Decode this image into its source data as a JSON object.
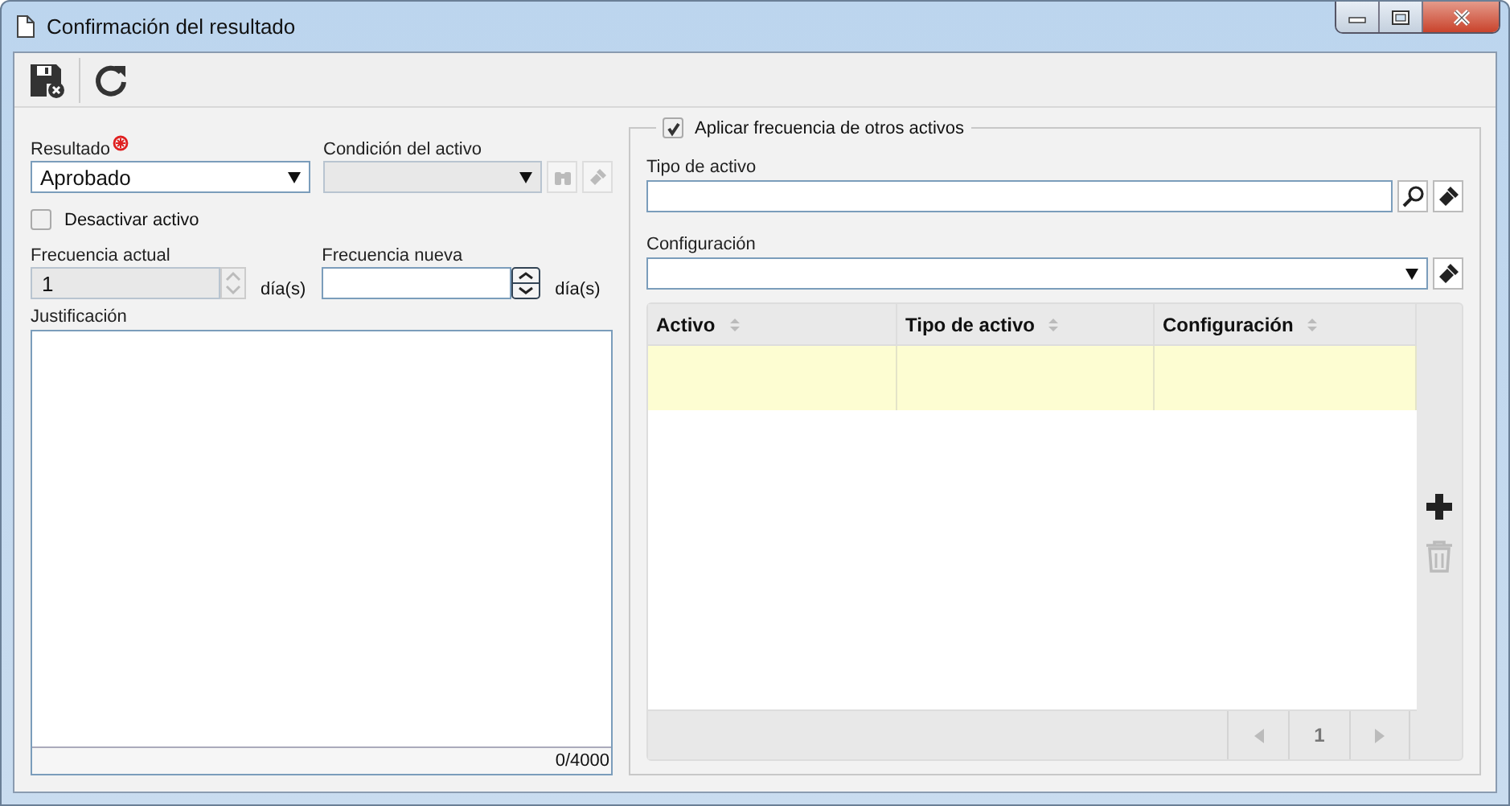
{
  "window": {
    "title": "Confirmación del resultado"
  },
  "form": {
    "resultado": {
      "label": "Resultado",
      "required": true,
      "value": "Aprobado"
    },
    "condicion": {
      "label": "Condición del activo",
      "disabled": true
    },
    "desactivar": {
      "label": "Desactivar activo",
      "checked": false
    },
    "frecuencia_actual": {
      "label": "Frecuencia actual",
      "value": "1",
      "disabled": true,
      "unit": "día(s)"
    },
    "frecuencia_nueva": {
      "label": "Frecuencia nueva",
      "unit": "día(s)"
    },
    "justificacion": {
      "label": "Justificación",
      "counter": "0/4000"
    }
  },
  "group": {
    "label": "Aplicar frecuencia de otros activos",
    "checked": true,
    "tipo_de_activo": {
      "label": "Tipo de activo"
    },
    "configuracion": {
      "label": "Configuración"
    },
    "table": {
      "columns": [
        "Activo",
        "Tipo de activo",
        "Configuración"
      ],
      "rows": [
        {
          "selected": true
        }
      ],
      "page": "1"
    }
  }
}
